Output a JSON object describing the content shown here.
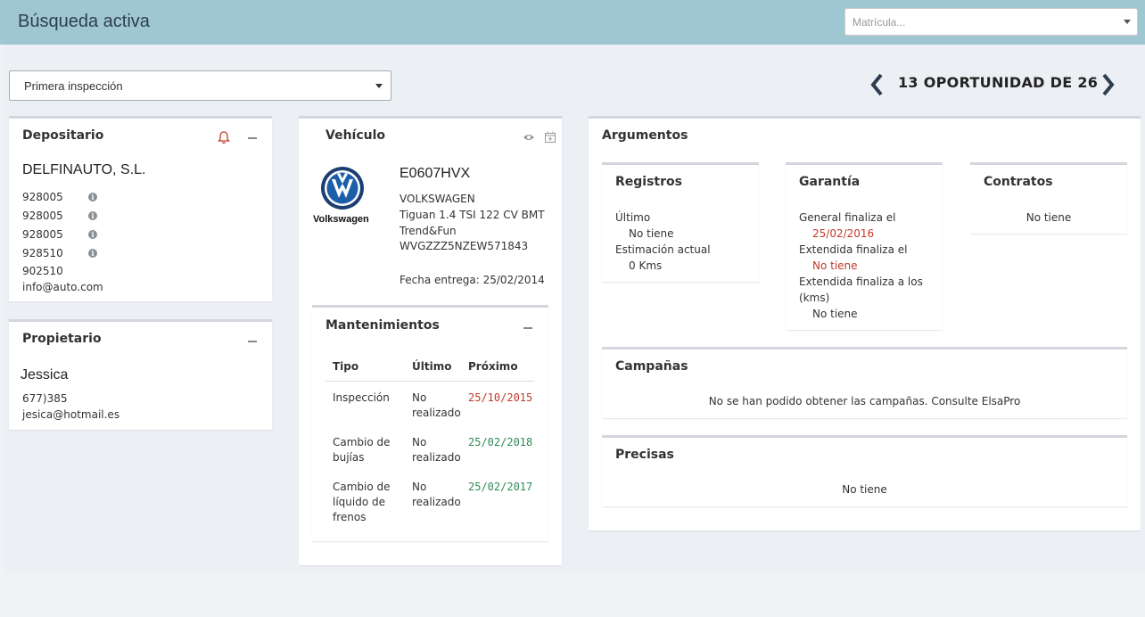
{
  "header": {
    "title": "Búsqueda activa",
    "plate_placeholder": "Matrícula..."
  },
  "filter": {
    "selected": "Primera inspección"
  },
  "nav": {
    "prev_icon": "chevron-left-icon",
    "label": "13 OPORTUNIDAD DE 26",
    "next_icon": "chevron-right-icon"
  },
  "depositario": {
    "title": "Depositario",
    "name": "DELFINAUTO, S.L.",
    "phones": [
      "928005",
      "928005",
      "928005",
      "928510",
      "902510"
    ],
    "email": "info@auto.com"
  },
  "propietario": {
    "title": "Propietario",
    "name": "Jessica",
    "phone": "677)385",
    "email": "jesica@hotmail.es"
  },
  "vehiculo": {
    "title": "Vehículo",
    "brand_logo_text": "Volkswagen",
    "plate": "E0607HVX",
    "make": "VOLKSWAGEN",
    "model_line1": "Tiguan 1.4 TSI 122 CV BMT",
    "model_line2": "Trend&Fun",
    "vin": "WVGZZZ5NZEW571843",
    "delivery": "Fecha entrega: 25/02/2014"
  },
  "mantenimientos": {
    "title": "Mantenimientos",
    "headers": [
      "Tipo",
      "Último",
      "Próximo"
    ],
    "rows": [
      {
        "tipo": [
          "Inspección"
        ],
        "ultimo": [
          "No",
          "realizado"
        ],
        "proximo": "25/10/2015",
        "status": "overdue"
      },
      {
        "tipo": [
          "Cambio de",
          "bujías"
        ],
        "ultimo": [
          "No",
          "realizado"
        ],
        "proximo": "25/02/2018",
        "status": "ok"
      },
      {
        "tipo": [
          "Cambio de",
          "líquido de",
          "frenos"
        ],
        "ultimo": [
          "No",
          "realizado"
        ],
        "proximo": "25/02/2017",
        "status": "ok"
      }
    ]
  },
  "argumentos": {
    "title": "Argumentos",
    "registros": {
      "title": "Registros",
      "ultimo_label": "Último",
      "ultimo_value": "No tiene",
      "estimacion_label": "Estimación actual",
      "estimacion_value": "0 Kms"
    },
    "garantia": {
      "title": "Garantía",
      "general_label": "General finaliza el",
      "general_value": "25/02/2016",
      "extendida_label": "Extendida finaliza el",
      "extendida_value": "No tiene",
      "extendida_kms_label_1": "Extendida finaliza a los",
      "extendida_kms_label_2": "(kms)",
      "extendida_kms_value": "No tiene"
    },
    "contratos": {
      "title": "Contratos",
      "value": "No tiene"
    },
    "campanas": {
      "title": "Campañas",
      "value": "No se han podido obtener las campañas. Consulte ElsaPro"
    },
    "precisas": {
      "title": "Precisas",
      "value": "No tiene"
    }
  },
  "colors": {
    "header": "#9fc7d2",
    "red": "#c0392b",
    "green": "#2e8b57"
  }
}
